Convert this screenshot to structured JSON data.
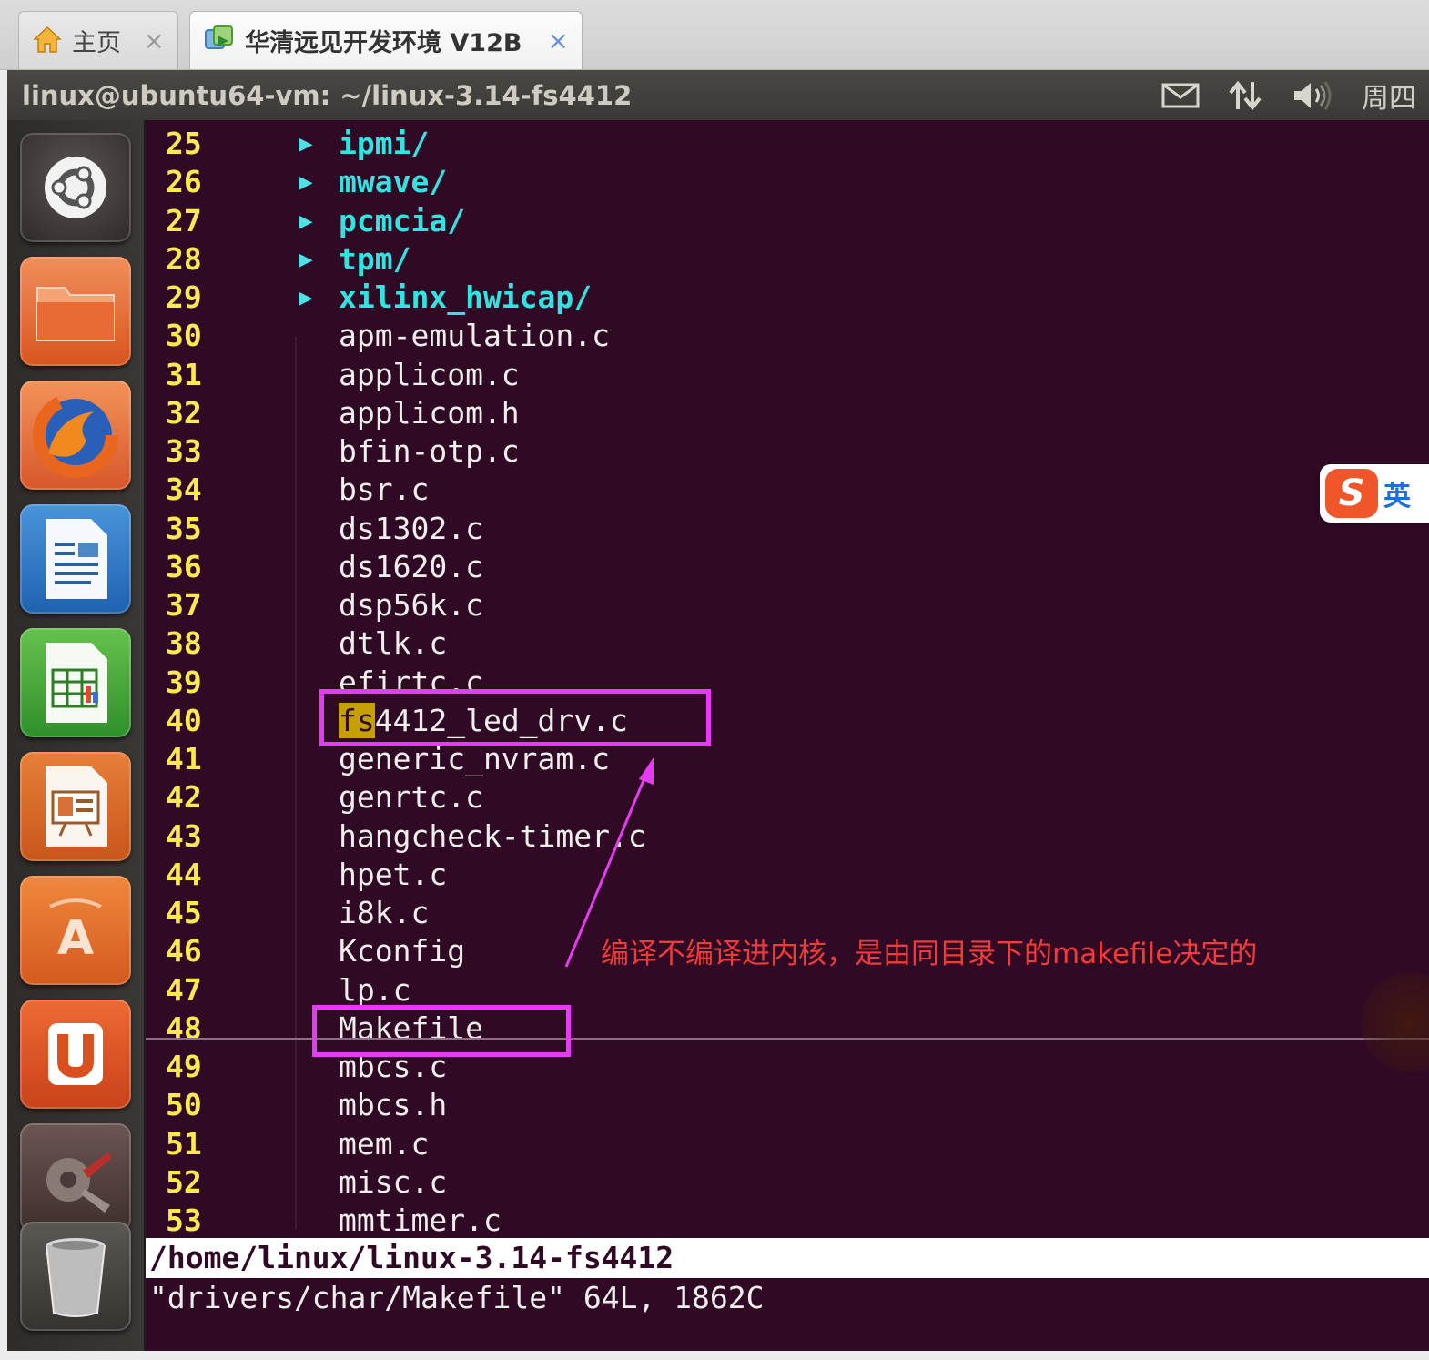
{
  "tabs": [
    {
      "label": "主页",
      "close": "×"
    },
    {
      "label": "华清远见开发环境 V12B",
      "close": "×"
    }
  ],
  "panel": {
    "window_title": "linux@ubuntu64-vm: ~/linux-3.14-fs4412",
    "clock": "周四"
  },
  "launcher": {
    "items": [
      "dash-home",
      "files",
      "firefox",
      "libreoffice-writer",
      "libreoffice-calc",
      "libreoffice-impress",
      "ubuntu-software-center",
      "ubuntu-one",
      "system-settings",
      "trash"
    ]
  },
  "terminal": {
    "lines": [
      {
        "n": "25",
        "name": "ipmi/",
        "dir": true
      },
      {
        "n": "26",
        "name": "mwave/",
        "dir": true
      },
      {
        "n": "27",
        "name": "pcmcia/",
        "dir": true
      },
      {
        "n": "28",
        "name": "tpm/",
        "dir": true
      },
      {
        "n": "29",
        "name": "xilinx_hwicap/",
        "dir": true
      },
      {
        "n": "30",
        "name": "apm-emulation.c"
      },
      {
        "n": "31",
        "name": "applicom.c"
      },
      {
        "n": "32",
        "name": "applicom.h"
      },
      {
        "n": "33",
        "name": "bfin-otp.c"
      },
      {
        "n": "34",
        "name": "bsr.c"
      },
      {
        "n": "35",
        "name": "ds1302.c"
      },
      {
        "n": "36",
        "name": "ds1620.c"
      },
      {
        "n": "37",
        "name": "dsp56k.c"
      },
      {
        "n": "38",
        "name": "dtlk.c"
      },
      {
        "n": "39",
        "name": "efirtc.c"
      },
      {
        "n": "40",
        "name": "4412_led_drv.c",
        "highlight": "fs"
      },
      {
        "n": "41",
        "name": "generic_nvram.c"
      },
      {
        "n": "42",
        "name": "genrtc.c"
      },
      {
        "n": "43",
        "name": "hangcheck-timer.c"
      },
      {
        "n": "44",
        "name": "hpet.c"
      },
      {
        "n": "45",
        "name": "i8k.c"
      },
      {
        "n": "46",
        "name": "Kconfig"
      },
      {
        "n": "47",
        "name": "lp.c"
      },
      {
        "n": "48",
        "name": "Makefile"
      },
      {
        "n": "49",
        "name": "mbcs.c"
      },
      {
        "n": "50",
        "name": "mbcs.h"
      },
      {
        "n": "51",
        "name": "mem.c"
      },
      {
        "n": "52",
        "name": "misc.c"
      },
      {
        "n": "53",
        "name": "mmtimer.c"
      }
    ],
    "dir_arrow": "▶",
    "status_path": "/home/linux/linux-3.14-fs4412",
    "message": "\"drivers/char/Makefile\" 64L, 1862C"
  },
  "annotation": {
    "text": "编译不编译进内核，是由同目录下的makefile决定的"
  },
  "ime": {
    "logo": "S",
    "lang": "英"
  },
  "colors": {
    "terminal_bg": "#300a24",
    "line_number": "#fce94f",
    "directory": "#34e2e2",
    "annotation": "#e23df0",
    "annotation_text": "#f23a3a"
  }
}
